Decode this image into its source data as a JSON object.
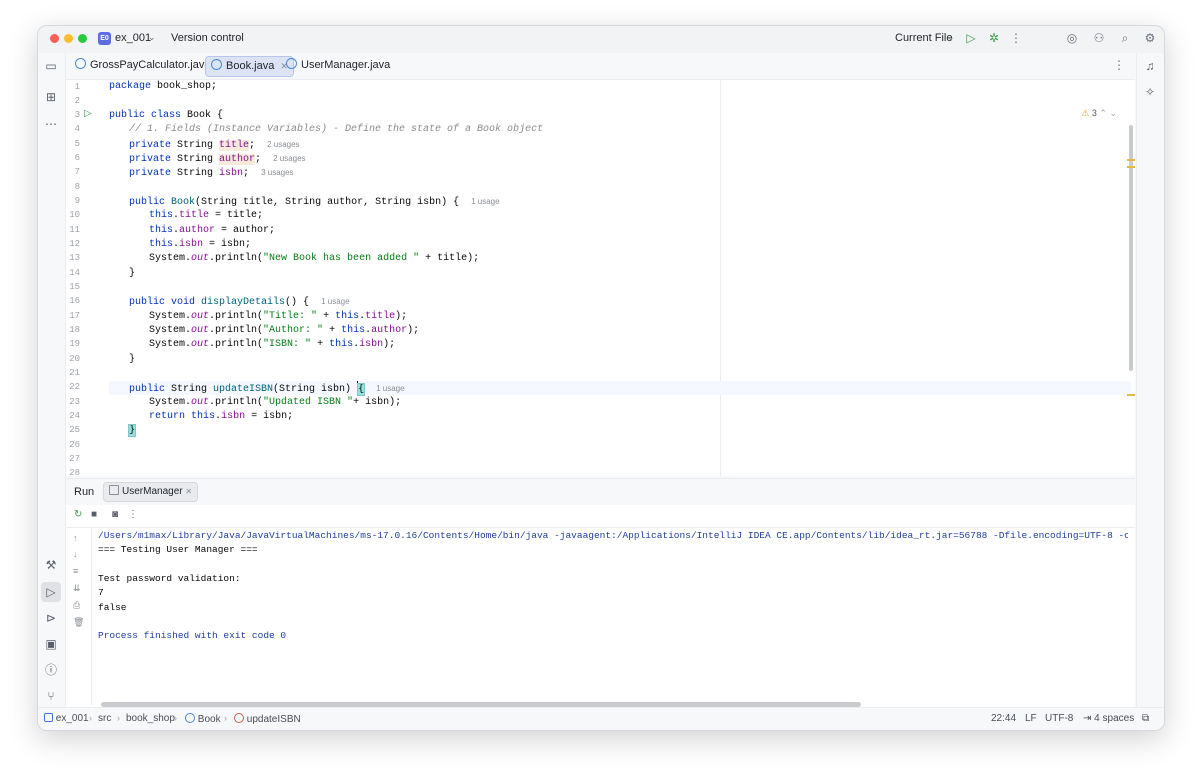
{
  "titlebar": {
    "project_badge": "E0",
    "project_name": "ex_001",
    "vcs_label": "Version control",
    "run_config": "Current File"
  },
  "tabs": [
    {
      "label": "GrossPayCalculator.java"
    },
    {
      "label": "Book.java",
      "active": true
    },
    {
      "label": "UserManager.java"
    }
  ],
  "editor": {
    "warning_count": "3",
    "line_numbers": [
      "1",
      "2",
      "3",
      "4",
      "5",
      "6",
      "7",
      "8",
      "9",
      "10",
      "11",
      "12",
      "13",
      "14",
      "15",
      "16",
      "17",
      "18",
      "19",
      "20",
      "21",
      "22",
      "23",
      "24",
      "25",
      "26",
      "27",
      "28"
    ],
    "hints": {
      "title_usages": "2 usages",
      "author_usages": "2 usages",
      "isbn_usages": "3 usages",
      "ctor_usages": "1 usage",
      "display_usages": "1 usage",
      "update_usages": "1 usage"
    },
    "code": {
      "l1_kw": "package",
      "l1_rest": " book_shop;",
      "l3_kw": "public class",
      "l3_rest": " Book {",
      "l4_cmt": "// 1. Fields (Instance Variables) - Define the state of a Book object",
      "kw_private": "private",
      "type_string": " String ",
      "f_title": "title",
      "f_author": "author",
      "f_isbn": "isbn",
      "semi": ";",
      "l9_kw": "public",
      "l9_name": "Book",
      "l9_rest": "(String title, String author, String isbn) {",
      "kw_this": "this",
      "l10_rest": " = title;",
      "l11_rest": " = author;",
      "l12_rest": " = isbn;",
      "sys": "System.",
      "out": "out",
      "println": ".println(",
      "l13_str": "\"New Book has been added \"",
      "l13_rest": " + title);",
      "close_brace": "}",
      "l16_kw": "public void",
      "l16_name": "displayDetails",
      "l16_rest": "() {",
      "l17_str": "\"Title: \"",
      "l18_str": "\"Author: \"",
      "l19_str": "\"ISBN: \"",
      "plus": " + ",
      "close_call": ");",
      "l22_kw": "public",
      "l22_type": " String ",
      "l22_name": "updateISBN",
      "l22_rest": "(String isbn) ",
      "open_brace": "{",
      "l23_str": "\"Updated ISBN \"",
      "l23_rest": "+ isbn);",
      "l24_kw": "return",
      "l24_rest": " = isbn;"
    }
  },
  "run": {
    "title": "Run",
    "tab_label": "UserManager",
    "console": [
      {
        "kind": "cmd",
        "text": "/Users/m1max/Library/Java/JavaVirtualMachines/ms-17.0.16/Contents/Home/bin/java -javaagent:/Applications/IntelliJ IDEA CE.app/Contents/lib/idea_rt.jar=56788 -Dfile.encoding=UTF-8 -classpath /Users/m1max"
      },
      {
        "kind": "out",
        "text": "=== Testing User Manager ==="
      },
      {
        "kind": "out",
        "text": ""
      },
      {
        "kind": "out",
        "text": "Test password validation:"
      },
      {
        "kind": "out",
        "text": "7"
      },
      {
        "kind": "out",
        "text": "false"
      },
      {
        "kind": "out",
        "text": ""
      },
      {
        "kind": "exit",
        "text": "Process finished with exit code 0"
      }
    ]
  },
  "statusbar": {
    "breadcrumbs": [
      "ex_001",
      "src",
      "book_shop",
      "Book",
      "updateISBN"
    ],
    "position": "22:44",
    "line_ending": "LF",
    "encoding": "UTF-8",
    "indent": "4 spaces"
  }
}
